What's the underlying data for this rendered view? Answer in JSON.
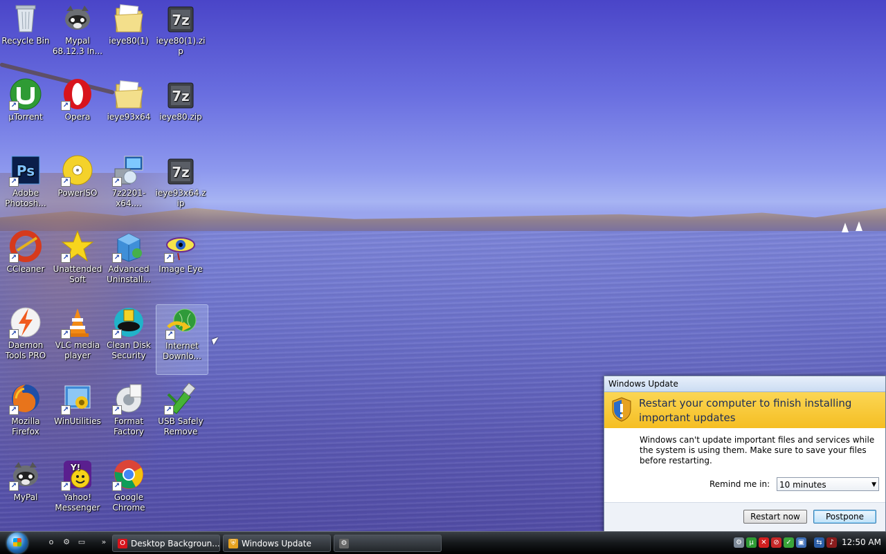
{
  "desktop": {
    "icons": [
      {
        "label": "Recycle Bin"
      },
      {
        "label": "Mypal 68.12.3 In..."
      },
      {
        "label": "ieye80(1)"
      },
      {
        "label": "ieye80(1).zip"
      },
      {
        "label": "µTorrent"
      },
      {
        "label": "Opera"
      },
      {
        "label": "ieye93x64"
      },
      {
        "label": "ieye80.zip"
      },
      {
        "label": "Adobe Photosh..."
      },
      {
        "label": "PowerISO"
      },
      {
        "label": "7z2201-x64...."
      },
      {
        "label": "ieye93x64.zip"
      },
      {
        "label": "CCleaner"
      },
      {
        "label": "Unattended Soft"
      },
      {
        "label": "Advanced Uninstall..."
      },
      {
        "label": "Image Eye"
      },
      {
        "label": "Daemon Tools PRO"
      },
      {
        "label": "VLC media player"
      },
      {
        "label": "Clean Disk Security"
      },
      {
        "label": "Internet Downlo..."
      },
      {
        "label": "Mozilla Firefox"
      },
      {
        "label": "WinUtilities"
      },
      {
        "label": "Format Factory"
      },
      {
        "label": "USB Safely Remove"
      },
      {
        "label": "MyPal"
      },
      {
        "label": "Yahoo! Messenger"
      },
      {
        "label": "Google Chrome"
      }
    ]
  },
  "windows_update": {
    "title": "Windows Update",
    "heading": "Restart your computer to finish installing important updates",
    "body": "Windows can't update important files and services while the system is using them. Make sure to save your files before restarting.",
    "remind_label": "Remind me in:",
    "remind_value": "10 minutes",
    "restart_button": "Restart now",
    "postpone_button": "Postpone"
  },
  "taskbar": {
    "tasks": [
      {
        "label": "Desktop Backgroun..."
      },
      {
        "label": "Windows Update"
      },
      {
        "label": ""
      }
    ],
    "clock": "12:50 AM"
  }
}
